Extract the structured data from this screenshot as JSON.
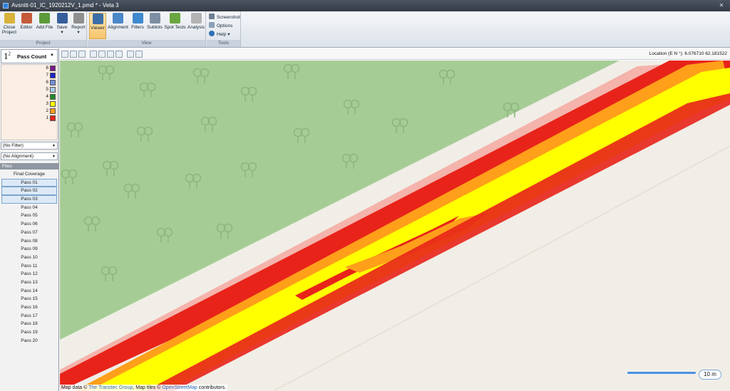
{
  "window": {
    "title": "Avsnitt-01_IC_1920212V_1.pmd * - Veta 3"
  },
  "ribbon": {
    "groups": {
      "project": "Project",
      "view": "View",
      "tools": "Tools"
    },
    "buttons": [
      {
        "label1": "Close",
        "label2": "Project",
        "icon": "close-project-icon",
        "color": "#d8b23a"
      },
      {
        "label1": "Editor",
        "label2": "",
        "icon": "editor-icon",
        "color": "#c45a3a"
      },
      {
        "label1": "Add File",
        "label2": "",
        "icon": "add-file-icon",
        "color": "#5b9b3a"
      },
      {
        "label1": "Save",
        "label2": "▾",
        "icon": "save-icon",
        "color": "#355f9b"
      },
      {
        "label1": "Report",
        "label2": "▾",
        "icon": "report-icon",
        "color": "#8f8f8f"
      },
      {
        "label1": "Viewer",
        "label2": "",
        "icon": "viewer-icon",
        "color": "#3d6fa6"
      },
      {
        "label1": "Alignment",
        "label2": "",
        "icon": "alignment-icon",
        "color": "#4b88c9"
      },
      {
        "label1": "Filters",
        "label2": "",
        "icon": "filters-icon",
        "color": "#3f89cf"
      },
      {
        "label1": "Sublots",
        "label2": "",
        "icon": "sublots-icon",
        "color": "#7e8fa3"
      },
      {
        "label1": "Spot Tests",
        "label2": "",
        "icon": "spot-tests-icon",
        "color": "#6aa640"
      },
      {
        "label1": "Analysis",
        "label2": "",
        "icon": "analysis-icon",
        "color": "#b3b3b3"
      }
    ],
    "tools": [
      {
        "label": "Screenshot",
        "icon": "screenshot-icon"
      },
      {
        "label": "Options",
        "icon": "options-icon"
      },
      {
        "label": "Help",
        "icon": "help-icon",
        "suffix": "▾"
      }
    ]
  },
  "legend": {
    "prefix": "1",
    "prefix_sup": "2",
    "title": "Pass Count",
    "items": [
      {
        "value": "8",
        "color": "#7a1b8c"
      },
      {
        "value": "7",
        "color": "#1a23c9"
      },
      {
        "value": "6",
        "color": "#6f8fd8"
      },
      {
        "value": "5",
        "color": "#a8c8e8"
      },
      {
        "value": "4",
        "color": "#1f8a2a"
      },
      {
        "value": "3",
        "color": "#ffff00"
      },
      {
        "value": "2",
        "color": "#ff9f1a"
      },
      {
        "value": "1",
        "color": "#e8231a"
      }
    ]
  },
  "filter": {
    "value": "(No Filter)"
  },
  "alignment": {
    "value": "(No Alignment)"
  },
  "files": {
    "header": "Files",
    "items": [
      "Final Coverage",
      "Pass 01",
      "Pass 02",
      "Pass 03",
      "Pass 04",
      "Pass 05",
      "Pass 06",
      "Pass 07",
      "Pass 08",
      "Pass 09",
      "Pass 10",
      "Pass 11",
      "Pass 12",
      "Pass 13",
      "Pass 14",
      "Pass 15",
      "Pass 16",
      "Pass 17",
      "Pass 18",
      "Pass 19",
      "Pass 20"
    ],
    "selected": [
      "Pass 01",
      "Pass 02",
      "Pass 03"
    ]
  },
  "map": {
    "location": "Location (E N °): 6.076710 62.181522",
    "scale": "10 m",
    "attribution": {
      "prefix": "Map data © ",
      "link1": "The Transtec Group",
      "middle": ", Map tiles © ",
      "link2": "OpenStreetMap",
      "suffix": " contributors."
    },
    "colors": {
      "park": "#a6cc96",
      "road": "#f1eee7",
      "pass1": "#e8231a",
      "pass2": "#ff9f1a",
      "pass3": "#ffff00"
    }
  }
}
